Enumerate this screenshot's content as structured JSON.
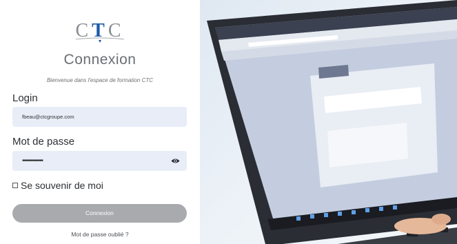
{
  "logo": {
    "text_left": "C",
    "text_mid": "T",
    "text_right": "C"
  },
  "form": {
    "title": "Connexion",
    "subtitle": "Bienvenue dans l'espace de formation CTC",
    "login_label": "Login",
    "login_value": "fbeau@ctcgroupe.com",
    "password_label": "Mot de passe",
    "password_value": "••••••••••••",
    "remember_label": "Se souvenir de moi",
    "submit_label": "Connexion",
    "forgot_label": "Mot de passe oublié ?"
  },
  "colors": {
    "accent": "#1e5aa8",
    "field_bg": "#e8edf8",
    "button_bg": "#a8aaad"
  },
  "photo": {
    "icon": "laptop-photo"
  }
}
